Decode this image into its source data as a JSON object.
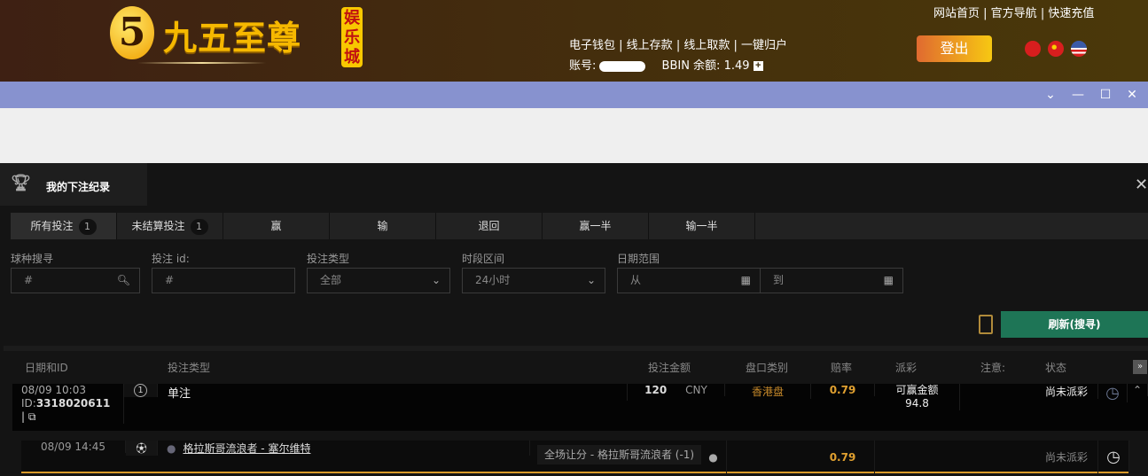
{
  "header": {
    "logo_glyph": "5",
    "logo_text": "九五至尊",
    "logo_badge": "娱乐城",
    "top_links": [
      "网站首页",
      "官方导航",
      "快速充值"
    ],
    "account_links": [
      "电子钱包",
      "线上存款",
      "线上取款",
      "一键归户"
    ],
    "account_label": "账号:",
    "balance_label": "BBIN 余额:",
    "balance": "1.49",
    "logout": "登出"
  },
  "panel": {
    "title": "我的下注纪录"
  },
  "tabs": [
    {
      "label": "所有投注",
      "count": "1"
    },
    {
      "label": "未结算投注",
      "count": "1"
    },
    {
      "label": "赢"
    },
    {
      "label": "输"
    },
    {
      "label": "退回"
    },
    {
      "label": "赢一半"
    },
    {
      "label": "输一半"
    }
  ],
  "filters": {
    "sport_label": "球种搜寻",
    "sport_placeholder": "#",
    "id_label": "投注 id:",
    "id_placeholder": "#",
    "type_label": "投注类型",
    "type_value": "全部",
    "period_label": "时段区间",
    "period_value": "24小时",
    "date_label": "日期范围",
    "from": "从",
    "to": "到"
  },
  "refresh": "刷新(搜寻)",
  "columns": [
    "日期和ID",
    "投注类型",
    "投注金额",
    "盘口类别",
    "赔率",
    "派彩",
    "注意:",
    "状态"
  ],
  "bet": {
    "datetime": "08/09 10:03",
    "id_prefix": "ID:",
    "id": "3318020611",
    "count": "1",
    "type": "单注",
    "amount": "120",
    "currency": "CNY",
    "market": "香港盘",
    "odds": "0.79",
    "payout_label": "可赢金额",
    "payout": "94.8",
    "status": "尚未派彩"
  },
  "leg": {
    "datetime": "08/09 14:45",
    "match": "格拉斯哥流浪者 - 塞尔维特",
    "selection": "全场让分 - 格拉斯哥流浪者 (-1)",
    "odds": "0.79",
    "status": "尚未派彩"
  }
}
